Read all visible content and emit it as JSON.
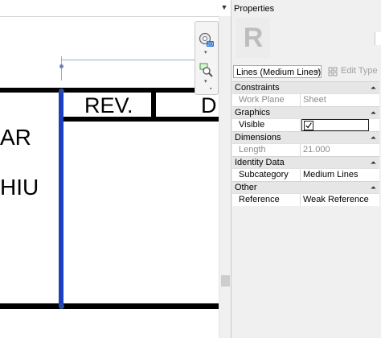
{
  "canvas": {
    "texts": {
      "rev_header": "REV.",
      "date_header_partial": "D",
      "left_text_1": "AR",
      "left_text_2": "HIU"
    }
  },
  "properties": {
    "title": "Properties",
    "type_selector": {
      "value": "Lines (Medium Lines)"
    },
    "edit_type_label": "Edit Type",
    "sections": {
      "constraints": "Constraints",
      "graphics": "Graphics",
      "dimensions": "Dimensions",
      "identity": "Identity Data",
      "other": "Other"
    },
    "rows": {
      "work_plane": {
        "key": "Work Plane",
        "value": "Sheet"
      },
      "visible": {
        "key": "Visible",
        "checked": true
      },
      "length": {
        "key": "Length",
        "value": "21.000"
      },
      "subcategory": {
        "key": "Subcategory",
        "value": "Medium Lines"
      },
      "reference": {
        "key": "Reference",
        "value": "Weak Reference"
      }
    }
  },
  "icons": {
    "type_preview": "revit-r-logo-icon",
    "nav_2d_wheel": "steering-wheel-2d-icon",
    "nav_zoom": "zoom-region-icon",
    "collapse": "double-chevron-up-icon",
    "checkmark": "checkmark-icon"
  }
}
